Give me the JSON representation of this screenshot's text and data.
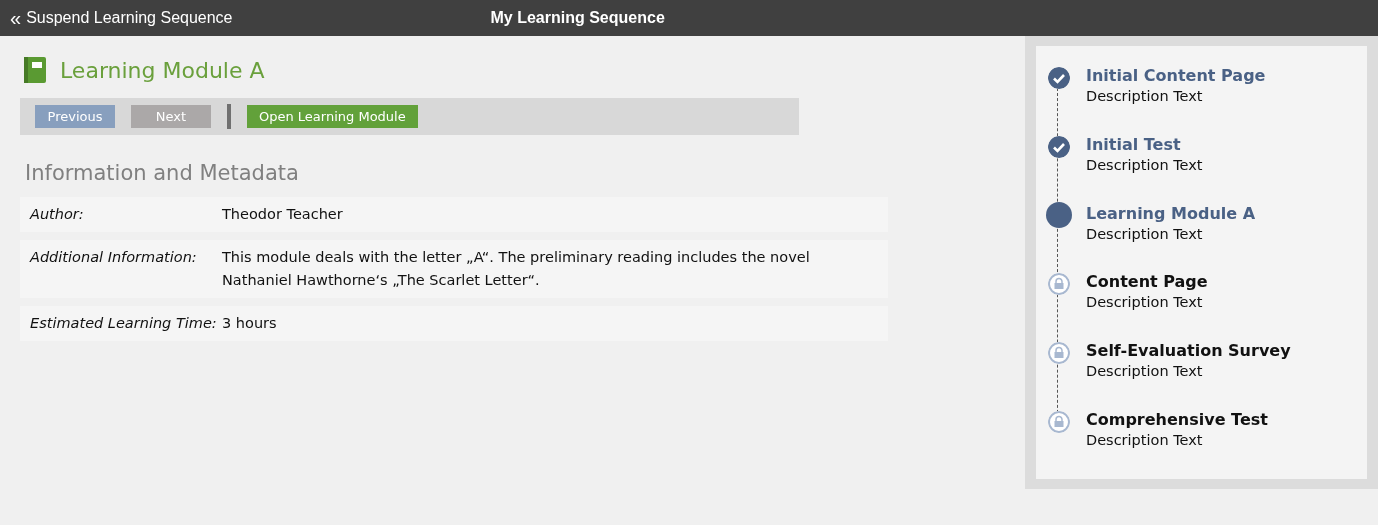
{
  "top_bar": {
    "back_icon": "«",
    "back_label": "Suspend Learning Sequence",
    "title": "My Learning Sequence"
  },
  "module": {
    "title": "Learning Module A"
  },
  "toolbar": {
    "buttons": [
      {
        "kind": "previous",
        "label": "Previous"
      },
      {
        "kind": "next",
        "label": "Next"
      },
      {
        "kind": "open",
        "label": "Open Learning Module"
      }
    ]
  },
  "info": {
    "heading": "Information and Metadata",
    "rows": [
      {
        "label": "Author:",
        "value": "Theodor Teacher"
      },
      {
        "label": "Additional Information:",
        "value": "This module deals with the letter „A“. The preliminary reading includes the novel Nathaniel Hawthorne‘s „The Scarlet Letter“."
      },
      {
        "label": "Estimated Learning Time:",
        "value": "3 hours"
      }
    ]
  },
  "sequence": [
    {
      "kind": "done",
      "title": "Initial Content Page",
      "description": "Description Text"
    },
    {
      "kind": "done",
      "title": "Initial Test",
      "description": "Description Text"
    },
    {
      "kind": "current",
      "title": "Learning Module A",
      "description": "Description Text"
    },
    {
      "kind": "locked",
      "title": "Content Page",
      "description": "Description Text"
    },
    {
      "kind": "locked",
      "title": "Self-Evaluation Survey",
      "description": "Description Text"
    },
    {
      "kind": "locked",
      "title": "Comprehensive Test",
      "description": "Description Text"
    }
  ]
}
